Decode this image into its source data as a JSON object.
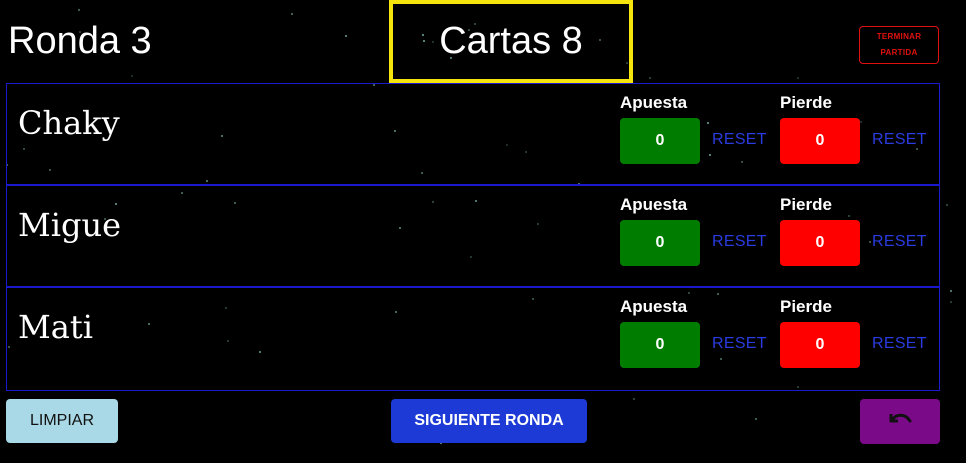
{
  "header": {
    "round_label": "Ronda 3",
    "cards_label": "Cartas 8",
    "end_game_label_1": "TERMINAR",
    "end_game_label_2": "PARTIDA"
  },
  "colors": {
    "cards_border": "#f5e50c",
    "bet_button": "#007d00",
    "lose_button": "#ff0000",
    "reset_link": "#2a3be0",
    "next_round_button": "#1e3ad6",
    "clear_button": "#a9d8e6",
    "undo_button": "#7a0a88"
  },
  "players": [
    {
      "name": "Chaky",
      "bet_label": "Apuesta",
      "bet_value": "0",
      "lose_label": "Pierde",
      "lose_value": "0",
      "reset_label": "RESET"
    },
    {
      "name": "Migue",
      "bet_label": "Apuesta",
      "bet_value": "0",
      "lose_label": "Pierde",
      "lose_value": "0",
      "reset_label": "RESET"
    },
    {
      "name": "Mati",
      "bet_label": "Apuesta",
      "bet_value": "0",
      "lose_label": "Pierde",
      "lose_value": "0",
      "reset_label": "RESET"
    }
  ],
  "footer": {
    "clear_label": "LIMPIAR",
    "next_round_label": "SIGUIENTE RONDA",
    "undo_icon": "undo-icon"
  }
}
